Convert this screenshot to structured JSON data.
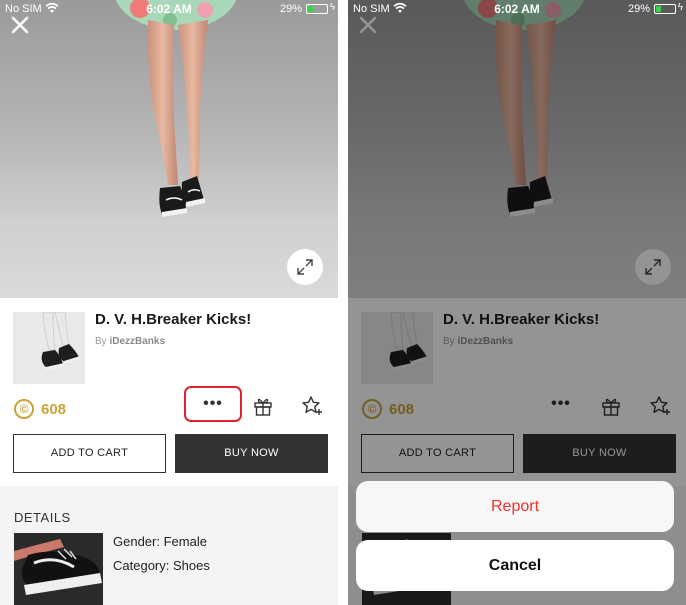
{
  "status_bar": {
    "carrier": "No SIM",
    "time": "6:02 AM",
    "battery": "29%",
    "battery_level": 0.29
  },
  "product": {
    "title": "D. V. H.Breaker Kicks!",
    "by_prefix": "By",
    "author": "iDezzBanks",
    "price": "608",
    "currency_symbol": "©",
    "more_label": "•••",
    "add_to_cart": "ADD TO CART",
    "buy_now": "BUY NOW"
  },
  "details": {
    "header": "DETAILS",
    "gender": "Gender: Female",
    "category": "Category: Shoes"
  },
  "action_sheet": {
    "report": "Report",
    "cancel": "Cancel"
  },
  "icons": {
    "close": "close-icon",
    "expand": "expand-icon",
    "gift": "gift-icon",
    "favorite": "star-plus-icon",
    "coin": "credits-icon",
    "wifi": "wifi-icon",
    "battery": "battery-icon"
  },
  "colors": {
    "accent_gold": "#c9a43a",
    "buy_now_bg": "#333333",
    "report_red": "#f0312d",
    "battery_green": "#3ad04a",
    "highlight_red": "#e0232c"
  }
}
